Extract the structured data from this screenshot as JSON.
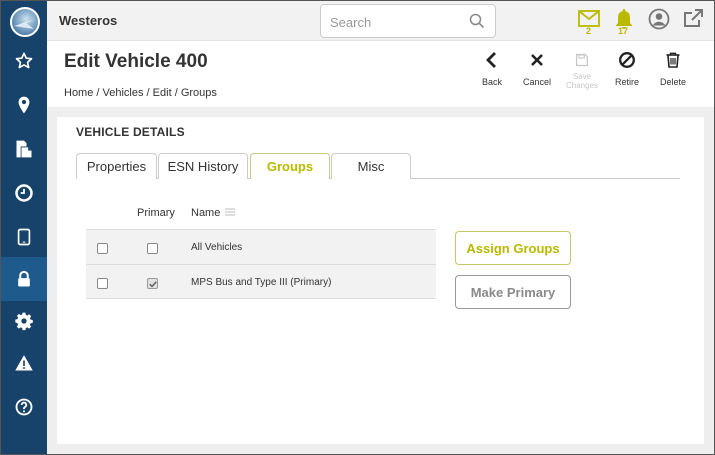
{
  "app": {
    "title": "Westeros"
  },
  "search": {
    "placeholder": "Search",
    "value": ""
  },
  "topbar": {
    "messages_count": "2",
    "alerts_count": "17",
    "accent_color": "#b9b900"
  },
  "sidebar": {
    "bg_color": "#17436b",
    "items": [
      {
        "icon": "star-icon"
      },
      {
        "icon": "map-pin-icon"
      },
      {
        "icon": "documents-icon"
      },
      {
        "icon": "clock-icon"
      },
      {
        "icon": "tablet-icon"
      },
      {
        "icon": "lock-icon",
        "active": true
      },
      {
        "icon": "gear-icon"
      },
      {
        "icon": "warning-icon"
      },
      {
        "icon": "help-icon"
      }
    ]
  },
  "page": {
    "title": "Edit Vehicle 400",
    "breadcrumb": [
      "Home",
      "Vehicles",
      "Edit",
      "Groups"
    ]
  },
  "actions": {
    "back": "Back",
    "cancel": "Cancel",
    "save_line1": "Save",
    "save_line2": "Changes",
    "retire": "Retire",
    "delete": "Delete"
  },
  "section": {
    "title": "VEHICLE DETAILS"
  },
  "tabs": [
    {
      "label": "Properties"
    },
    {
      "label": "ESN History"
    },
    {
      "label": "Groups",
      "active": true
    },
    {
      "label": "Misc"
    }
  ],
  "groups_table": {
    "columns": {
      "primary": "Primary",
      "name": "Name"
    },
    "rows": [
      {
        "name": "All Vehicles",
        "selected": false,
        "primary": false
      },
      {
        "name": "MPS Bus and Type III (Primary)",
        "selected": false,
        "primary": true
      }
    ]
  },
  "buttons": {
    "assign_groups": "Assign Groups",
    "make_primary": "Make Primary"
  }
}
